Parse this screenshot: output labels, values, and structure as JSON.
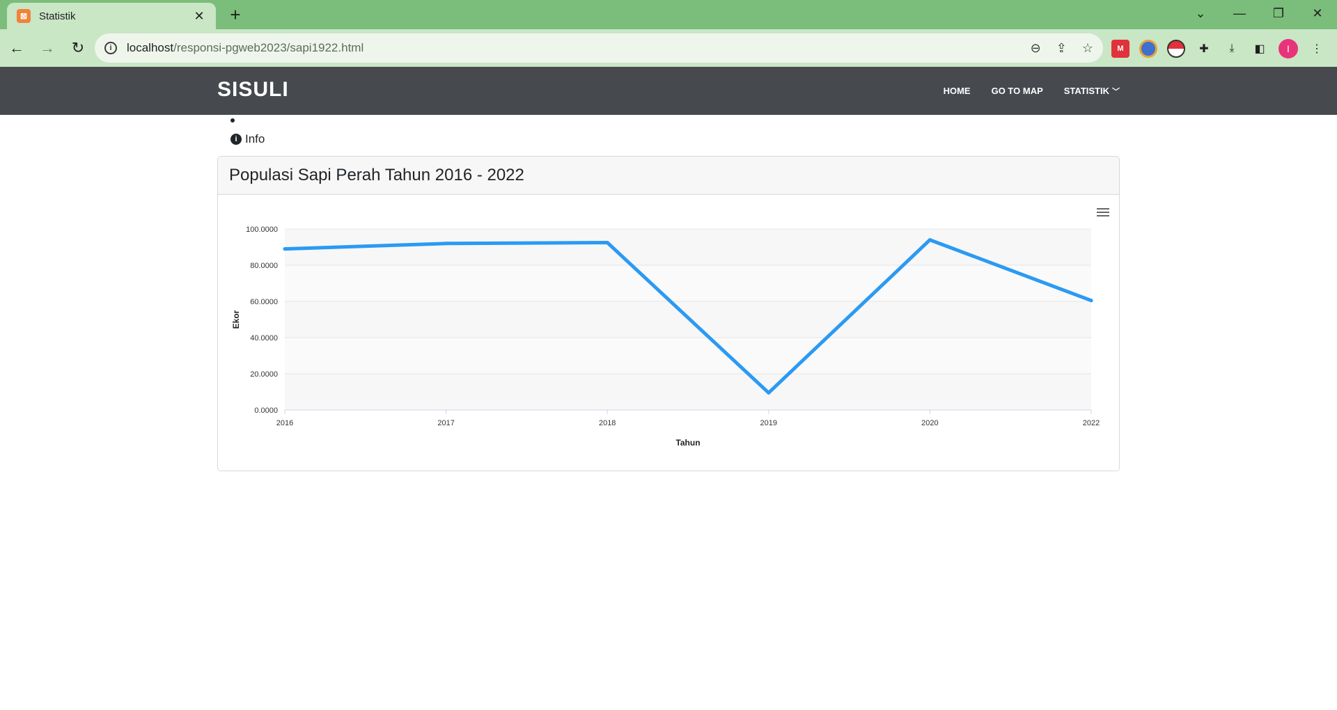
{
  "browser": {
    "tab_title": "Statistik",
    "tab_favicon": "xampp-icon",
    "url_host": "localhost",
    "url_path": "/responsi-pgweb2023/sapi1922.html",
    "profile_initial": "I"
  },
  "navbar": {
    "brand": "SISULI",
    "links": [
      "HOME",
      "GO TO MAP",
      "STATISTIK"
    ]
  },
  "page": {
    "info_label": "Info"
  },
  "card": {
    "title": "Populasi Sapi Perah Tahun 2016 - 2022"
  },
  "chart_data": {
    "type": "line",
    "x": [
      "2016",
      "2017",
      "2018",
      "2019",
      "2020",
      "2022"
    ],
    "series": [
      {
        "values": [
          89000,
          92000,
          92500,
          9500,
          94000,
          60500
        ],
        "color": "#2b9af3"
      }
    ],
    "xlabel": "Tahun",
    "ylabel": "Ekor",
    "ylim": [
      0,
      100000
    ],
    "yticks": [
      "0.0000",
      "20.0000",
      "40.0000",
      "60.0000",
      "80.0000",
      "100.0000"
    ],
    "grid": true,
    "legend": "none"
  }
}
